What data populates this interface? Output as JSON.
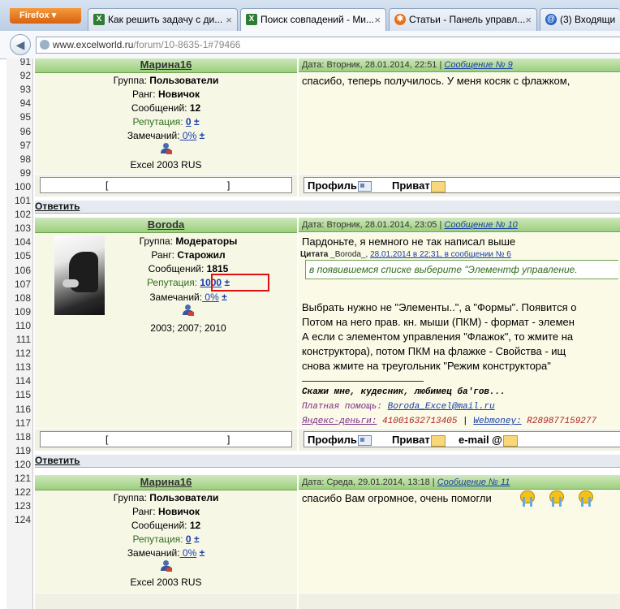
{
  "browser": {
    "menu_label": "Firefox",
    "tabs": [
      {
        "label": "Как решить задачу с ди...",
        "icon": "excel-icon",
        "icon_color": "#2e7d32"
      },
      {
        "label": "Поиск совпадений - Ми...",
        "icon": "excel-icon",
        "icon_color": "#2e7d32",
        "active": true
      },
      {
        "label": "Статьи - Панель управл...",
        "icon": "joomla-icon",
        "icon_color": "#e8701a"
      },
      {
        "label": "(3) Входящи",
        "icon": "mail-icon",
        "icon_color": "#2a66c4"
      }
    ],
    "close_glyph": "×",
    "url_domain": "www.excelworld.ru",
    "url_path": "/forum/10-8635-1#79466"
  },
  "line_numbers": [
    "91",
    "92",
    "93",
    "94",
    "95",
    "96",
    "97",
    "98",
    "99",
    "100",
    "101",
    "102",
    "103",
    "104",
    "105",
    "106",
    "107",
    "108",
    "109",
    "110",
    "111",
    "112",
    "113",
    "114",
    "115",
    "116",
    "117",
    "118",
    "119",
    "120",
    "121",
    "122",
    "123",
    "124"
  ],
  "labels": {
    "group": "Группа:",
    "rank": "Ранг:",
    "messages": "Сообщений:",
    "reputation": "Репутация:",
    "remarks": "Замечаний:",
    "plusminus": "±",
    "profile": "Профиль",
    "private": "Приват",
    "email": "e-mail @",
    "reply": "Ответить",
    "box_left": "[",
    "box_right": "]"
  },
  "posts": [
    {
      "author": "Марина16",
      "header": "Дата: Вторник, 28.01.2014, 22:51 |",
      "msg_link": "Сообщение № 9",
      "group": "Пользователи",
      "rank": "Новичок",
      "messages": "12",
      "reputation": "0",
      "remarks": " 0%",
      "software": "Excel 2003 RUS",
      "text": "спасибо, теперь получилось. У меня косяк с флажком,"
    },
    {
      "author": "Boroda",
      "header": "Дата: Вторник, 28.01.2014, 23:05 |",
      "msg_link": "Сообщение № 10",
      "group": "Модераторы",
      "rank": "Старожил",
      "messages": "1815",
      "reputation": "1000",
      "remarks": " 0%",
      "software": "2003; 2007; 2010",
      "text_intro": "Пардоньте, я немного не так написал выше",
      "quote_label": "Цитата",
      "quote_author": "_Boroda_,",
      "quote_link": "28.01.2014 в 22:31, в сообщении № 6",
      "quote_text": "в появившемся списке выберите \"Элементф управление.",
      "lines": [
        "Выбрать нужно не \"Элементы..\", а \"Формы\". Появится о",
        "Потом на него прав. кн. мыши (ПКМ) - формат - элемен",
        "А если с элементом управления \"Флажок\", то жмите на",
        "конструктора), потом ПКМ на флажке - Свойства - ищ",
        "снова жмите на треугольник \"Режим конструктора\""
      ],
      "sig1": "Скажи мне, кудесник, любимец ба'гов...",
      "sig2_label": "Платная помощь:",
      "sig2_link": "Boroda_Excel@mail.ru",
      "sig3_label": "Яндекс-деньги:",
      "sig3_value": "41001632713405",
      "sig3_sep": " | ",
      "sig3_link": "Webmoney:",
      "sig3_value2": "R289877159277"
    },
    {
      "author": "Марина16",
      "header": "Дата: Среда, 29.01.2014, 13:18 |",
      "msg_link": "Сообщение № 11",
      "group": "Пользователи",
      "rank": "Новичок",
      "messages": "12",
      "reputation": "0",
      "remarks": " 0%",
      "software": "Excel 2003 RUS",
      "text": "спасибо Вам огромное, очень помогли"
    }
  ]
}
